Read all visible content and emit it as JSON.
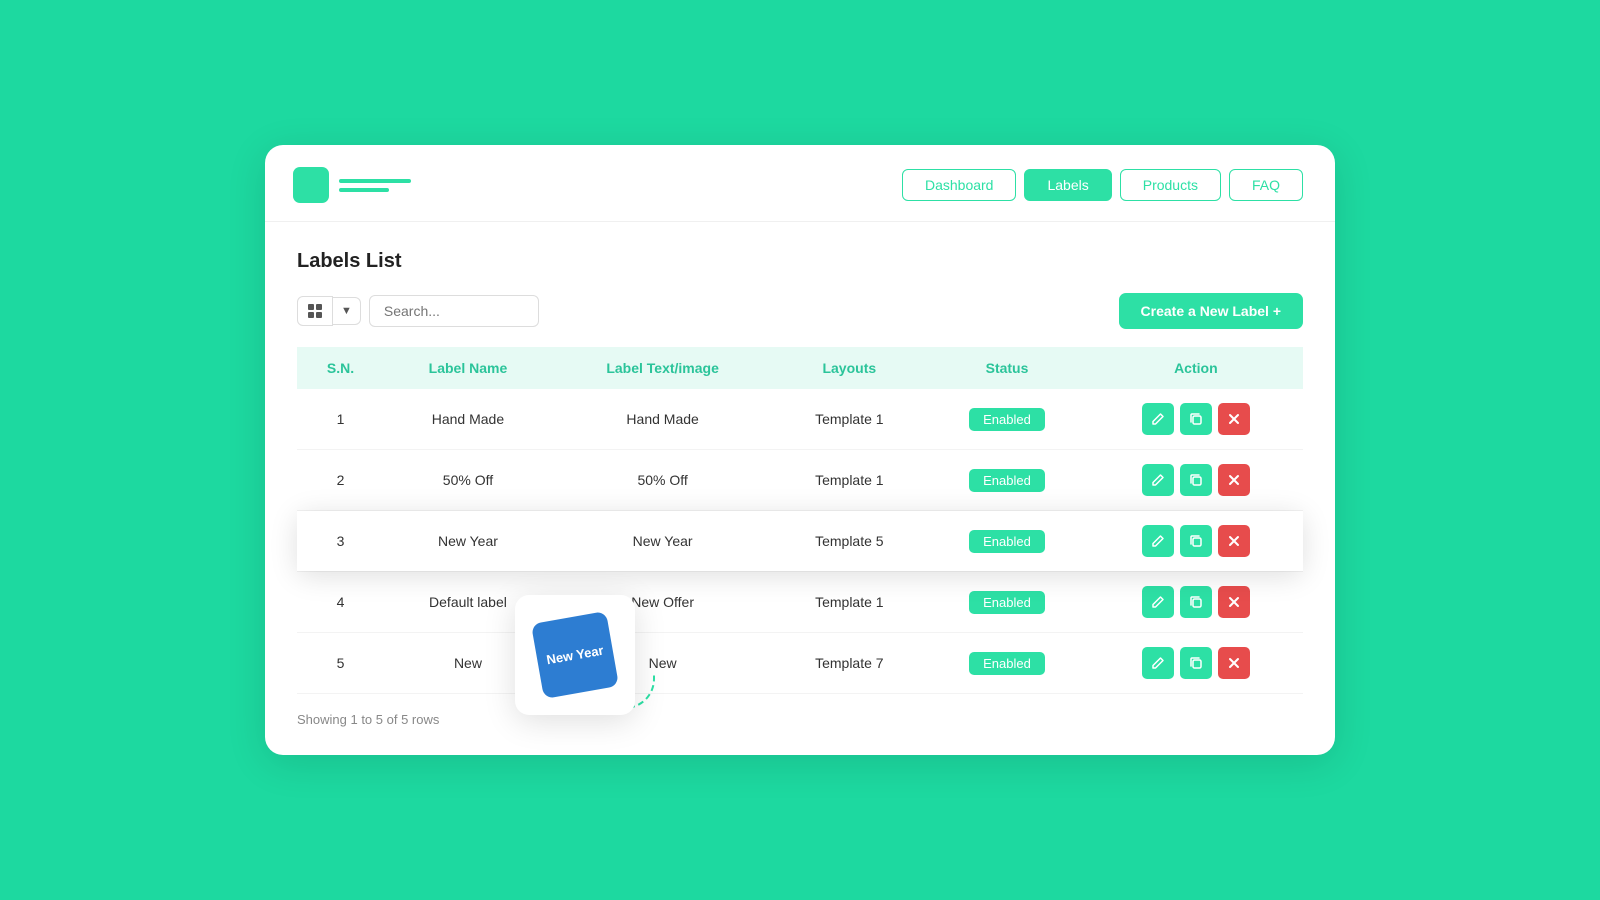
{
  "header": {
    "nav": [
      {
        "label": "Dashboard",
        "active": false
      },
      {
        "label": "Labels",
        "active": true
      },
      {
        "label": "Products",
        "active": false
      },
      {
        "label": "FAQ",
        "active": false
      }
    ]
  },
  "main": {
    "page_title": "Labels List",
    "search_placeholder": "Search...",
    "create_btn": "Create a New Label +",
    "table": {
      "columns": [
        "S.N.",
        "Label Name",
        "Label Text/image",
        "Layouts",
        "Status",
        "Action"
      ],
      "rows": [
        {
          "sn": "1",
          "name": "Hand Made",
          "text": "Hand Made",
          "layout": "Template 1",
          "status": "Enabled",
          "highlighted": false
        },
        {
          "sn": "2",
          "name": "50% Off",
          "text": "50% Off",
          "layout": "Template 1",
          "status": "Enabled",
          "highlighted": false
        },
        {
          "sn": "3",
          "name": "New Year",
          "text": "New Year",
          "layout": "Template 5",
          "status": "Enabled",
          "highlighted": true
        },
        {
          "sn": "4",
          "name": "Default label",
          "text": "New  Offer",
          "layout": "Template 1",
          "status": "Enabled",
          "highlighted": false
        },
        {
          "sn": "5",
          "name": "New",
          "text": "New",
          "layout": "Template 7",
          "status": "Enabled",
          "highlighted": false
        }
      ]
    },
    "footer": "Showing 1 to 5 of 5 rows",
    "preview": {
      "label_text": "New Year"
    }
  }
}
